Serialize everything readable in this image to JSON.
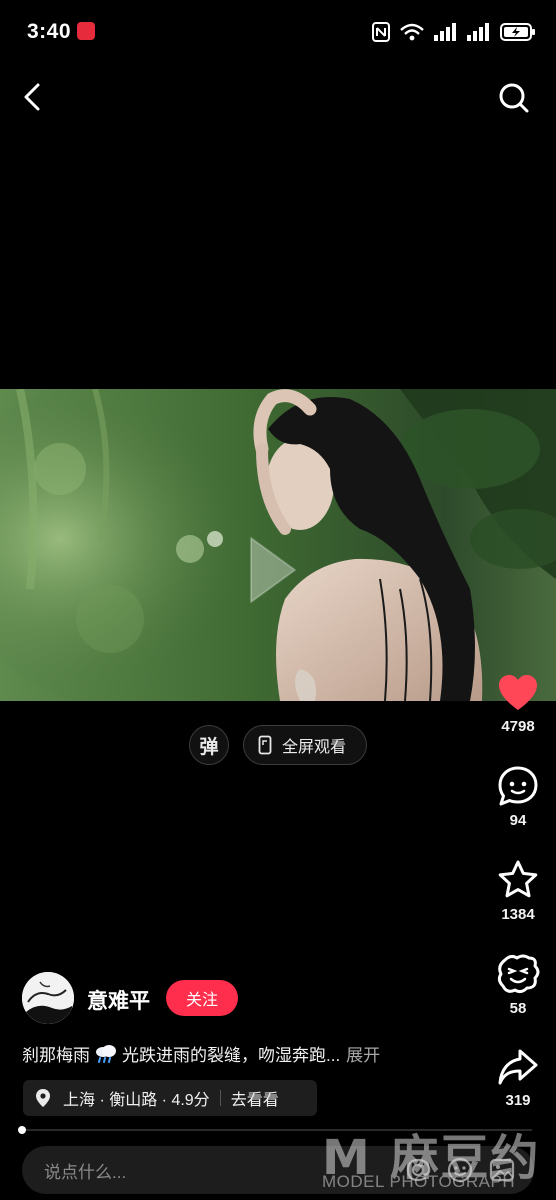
{
  "status_bar": {
    "time": "3:40"
  },
  "video": {
    "play_state": "paused"
  },
  "controls": {
    "danmaku_label": "弹",
    "fullscreen_label": "全屏观看"
  },
  "actions": {
    "like_count": "4798",
    "comment_count": "94",
    "favorite_count": "1384",
    "emoji_count": "58",
    "share_count": "319"
  },
  "author": {
    "name": "意难平",
    "follow_label": "关注"
  },
  "caption": {
    "text_before": "刹那梅雨",
    "text_after": " 光跌进雨的裂缝，吻湿奔跑...",
    "expand_label": "展开"
  },
  "location": {
    "city": "上海 · 衡山路 · 4.9分",
    "action_label": "去看看"
  },
  "progress": {
    "fraction": 0.0
  },
  "comment_bar": {
    "placeholder": "说点什么..."
  },
  "watermark": {
    "main": "M 麻豆约拍",
    "sub": "MODEL PHOTOGRAPH"
  },
  "colors": {
    "like_red": "#ff4757",
    "follow_red": "#ff2e4d",
    "background": "#000000"
  }
}
